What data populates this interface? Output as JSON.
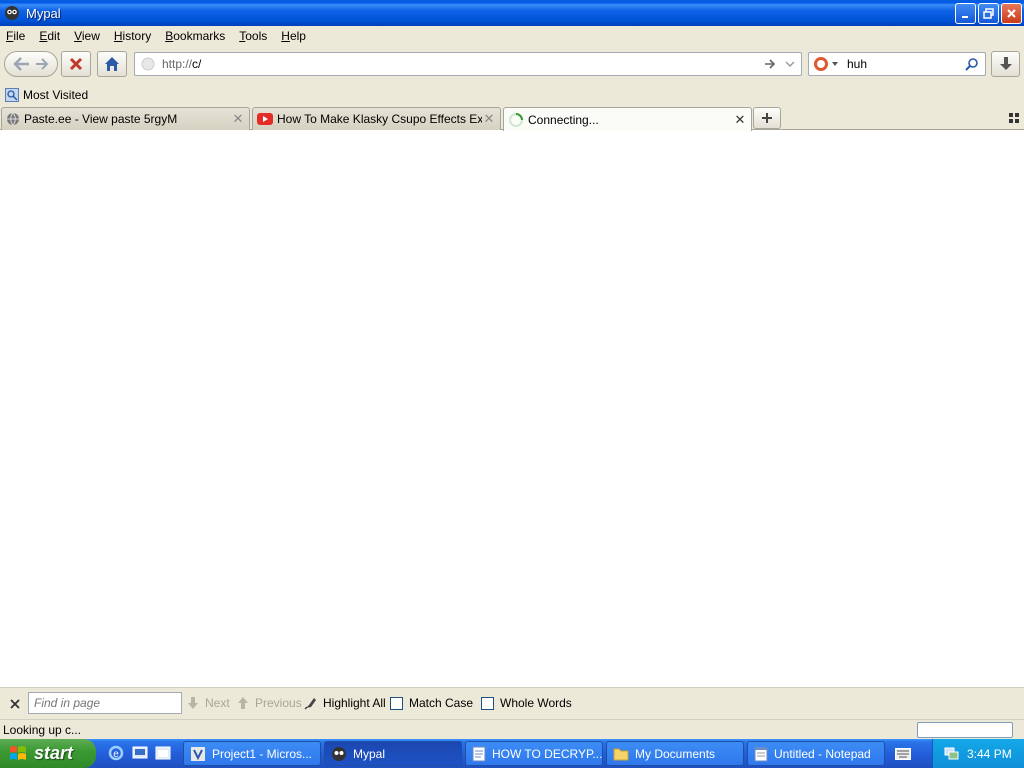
{
  "window": {
    "title": "Mypal"
  },
  "menu": [
    "File",
    "Edit",
    "View",
    "History",
    "Bookmarks",
    "Tools",
    "Help"
  ],
  "navigation": {
    "url_prefix": "http://",
    "url_host": "c/",
    "search_value": "huh"
  },
  "bookmarks": {
    "most_visited": "Most Visited"
  },
  "tabs": [
    {
      "label": "Paste.ee - View paste 5rgyM"
    },
    {
      "label": "How To Make Klasky Csupo Effects Exten..."
    },
    {
      "label": "Connecting..."
    }
  ],
  "findbar": {
    "placeholder": "Find in page",
    "next": "Next",
    "previous": "Previous",
    "highlight_all": "Highlight All",
    "match_case": "Match Case",
    "whole_words": "Whole Words"
  },
  "status": {
    "text": "Looking up c..."
  },
  "taskbar": {
    "start": "start",
    "tasks": [
      {
        "label": "Project1 - Micros..."
      },
      {
        "label": "Mypal"
      },
      {
        "label": "HOW TO DECRYP..."
      },
      {
        "label": "My Documents"
      },
      {
        "label": "Untitled - Notepad"
      }
    ],
    "clock": "3:44 PM"
  }
}
